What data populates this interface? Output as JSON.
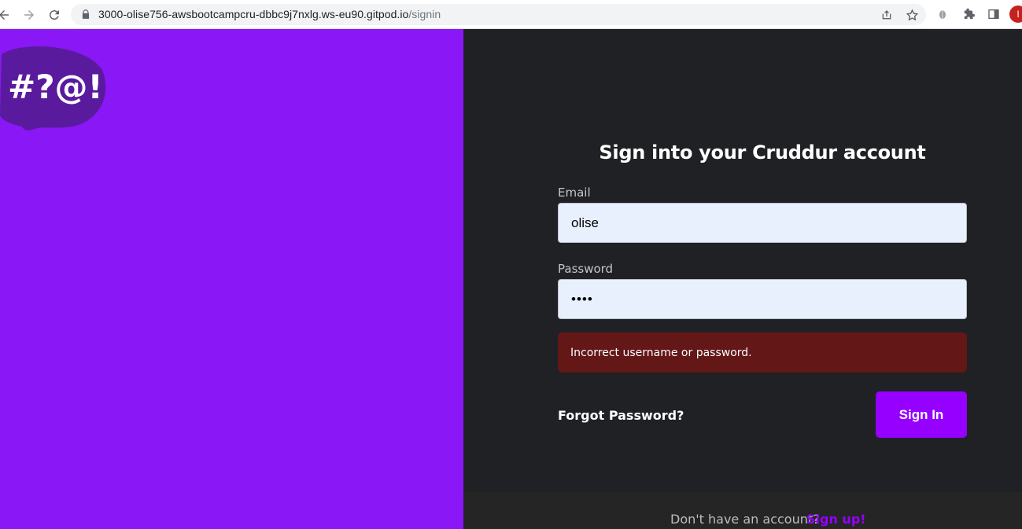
{
  "browser": {
    "url_host": "3000-olise756-awsbootcampcru-dbbc9j7nxlg.ws-eu90.gitpod.io",
    "url_path": "/signin",
    "profile_initial": "I",
    "icons": [
      "back-icon",
      "forward-icon",
      "reload-icon",
      "lock-icon",
      "share-icon",
      "bookmark-star-icon",
      "bug-extension-icon",
      "puzzle-extensions-icon",
      "side-panel-icon"
    ]
  },
  "logo": {
    "text": "#?@!"
  },
  "signin": {
    "title": "Sign into your Cruddur account",
    "email_label": "Email",
    "email_value": "olise",
    "password_label": "Password",
    "password_value": "••••",
    "error_message": "Incorrect username or password.",
    "forgot_label": "Forgot Password?",
    "submit_label": "Sign In"
  },
  "footer": {
    "prompt": "Don't have an account?",
    "signup_label": "Sign up!"
  },
  "colors": {
    "brand_purple": "#8a17f5",
    "button_purple": "#9500ff",
    "dark_bg": "#202124",
    "error_bg": "#641717",
    "input_bg": "#e8f0fe"
  }
}
